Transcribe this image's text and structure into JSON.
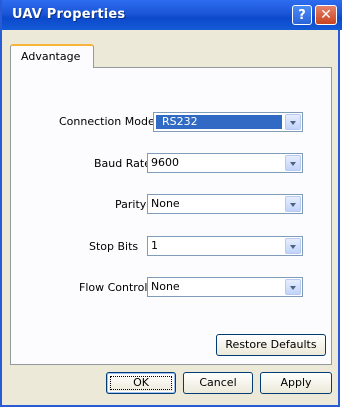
{
  "window": {
    "title": "UAV Properties",
    "help_label": "?",
    "close_label": "✕"
  },
  "tabs": [
    {
      "label": "Advantage"
    }
  ],
  "fields": [
    {
      "label": "Connection Mode",
      "value": "RS232",
      "selected": true
    },
    {
      "label": "Baud Rate",
      "value": "9600"
    },
    {
      "label": "Parity",
      "value": "None"
    },
    {
      "label": "Stop Bits",
      "value": "1"
    },
    {
      "label": "Flow Control",
      "value": "None"
    }
  ],
  "buttons": {
    "restore_defaults": "Restore Defaults",
    "ok": "OK",
    "cancel": "Cancel",
    "apply": "Apply"
  },
  "icons": {
    "help": "help-icon",
    "close": "close-icon",
    "dropdown": "chevron-down-icon"
  }
}
